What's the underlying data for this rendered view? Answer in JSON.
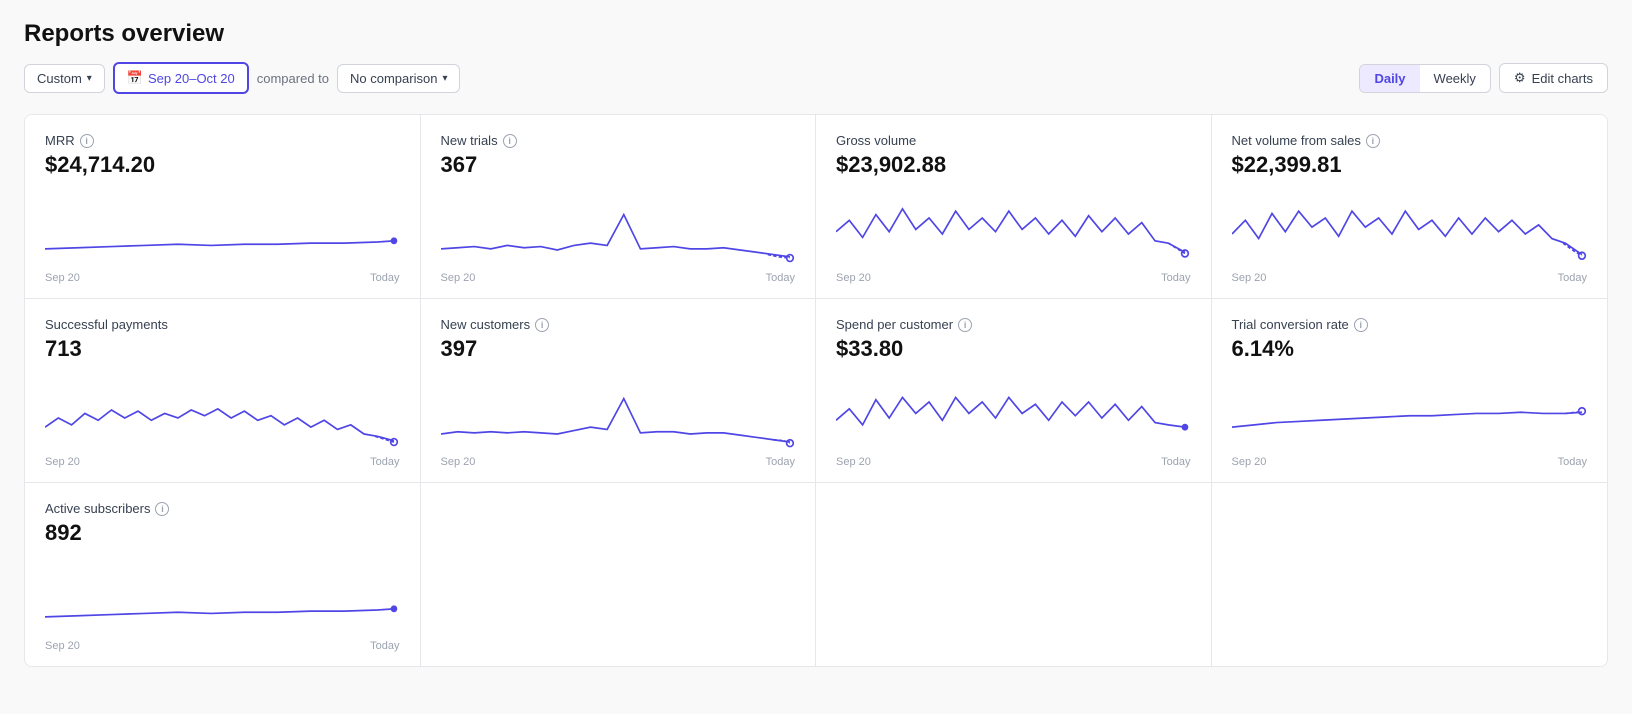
{
  "page": {
    "title": "Reports overview"
  },
  "toolbar": {
    "custom_label": "Custom",
    "date_range": "Sep 20–Oct 20",
    "compared_to": "compared to",
    "comparison_label": "No comparison",
    "daily_label": "Daily",
    "weekly_label": "Weekly",
    "edit_charts_label": "Edit charts"
  },
  "cards": [
    {
      "id": "mrr",
      "title": "MRR",
      "has_info": true,
      "value": "$24,714.20",
      "chart_type": "flat_rising",
      "date_start": "Sep 20",
      "date_end": "Today"
    },
    {
      "id": "new_trials",
      "title": "New trials",
      "has_info": true,
      "value": "367",
      "chart_type": "spiky",
      "date_start": "Sep 20",
      "date_end": "Today"
    },
    {
      "id": "gross_volume",
      "title": "Gross volume",
      "has_info": false,
      "value": "$23,902.88",
      "chart_type": "volatile",
      "date_start": "Sep 20",
      "date_end": "Today"
    },
    {
      "id": "net_volume",
      "title": "Net volume from sales",
      "has_info": true,
      "value": "$22,399.81",
      "chart_type": "volatile_down",
      "date_start": "Sep 20",
      "date_end": "Today"
    },
    {
      "id": "successful_payments",
      "title": "Successful payments",
      "has_info": false,
      "value": "713",
      "chart_type": "wavy",
      "date_start": "Sep 20",
      "date_end": "Today"
    },
    {
      "id": "new_customers",
      "title": "New customers",
      "has_info": true,
      "value": "397",
      "chart_type": "spiky2",
      "date_start": "Sep 20",
      "date_end": "Today"
    },
    {
      "id": "spend_per_customer",
      "title": "Spend per customer",
      "has_info": true,
      "value": "$33.80",
      "chart_type": "volatile2",
      "date_start": "Sep 20",
      "date_end": "Today"
    },
    {
      "id": "trial_conversion",
      "title": "Trial conversion rate",
      "has_info": true,
      "value": "6.14%",
      "chart_type": "gentle_rise",
      "date_start": "Sep 20",
      "date_end": "Today"
    },
    {
      "id": "active_subscribers",
      "title": "Active subscribers",
      "has_info": true,
      "value": "892",
      "chart_type": "flat_rising2",
      "date_start": "Sep 20",
      "date_end": "Today"
    }
  ],
  "colors": {
    "accent": "#4f46e5",
    "accent_light": "#ede9fe",
    "border": "#e5e7eb",
    "muted": "#9ca3af",
    "text": "#374151"
  }
}
